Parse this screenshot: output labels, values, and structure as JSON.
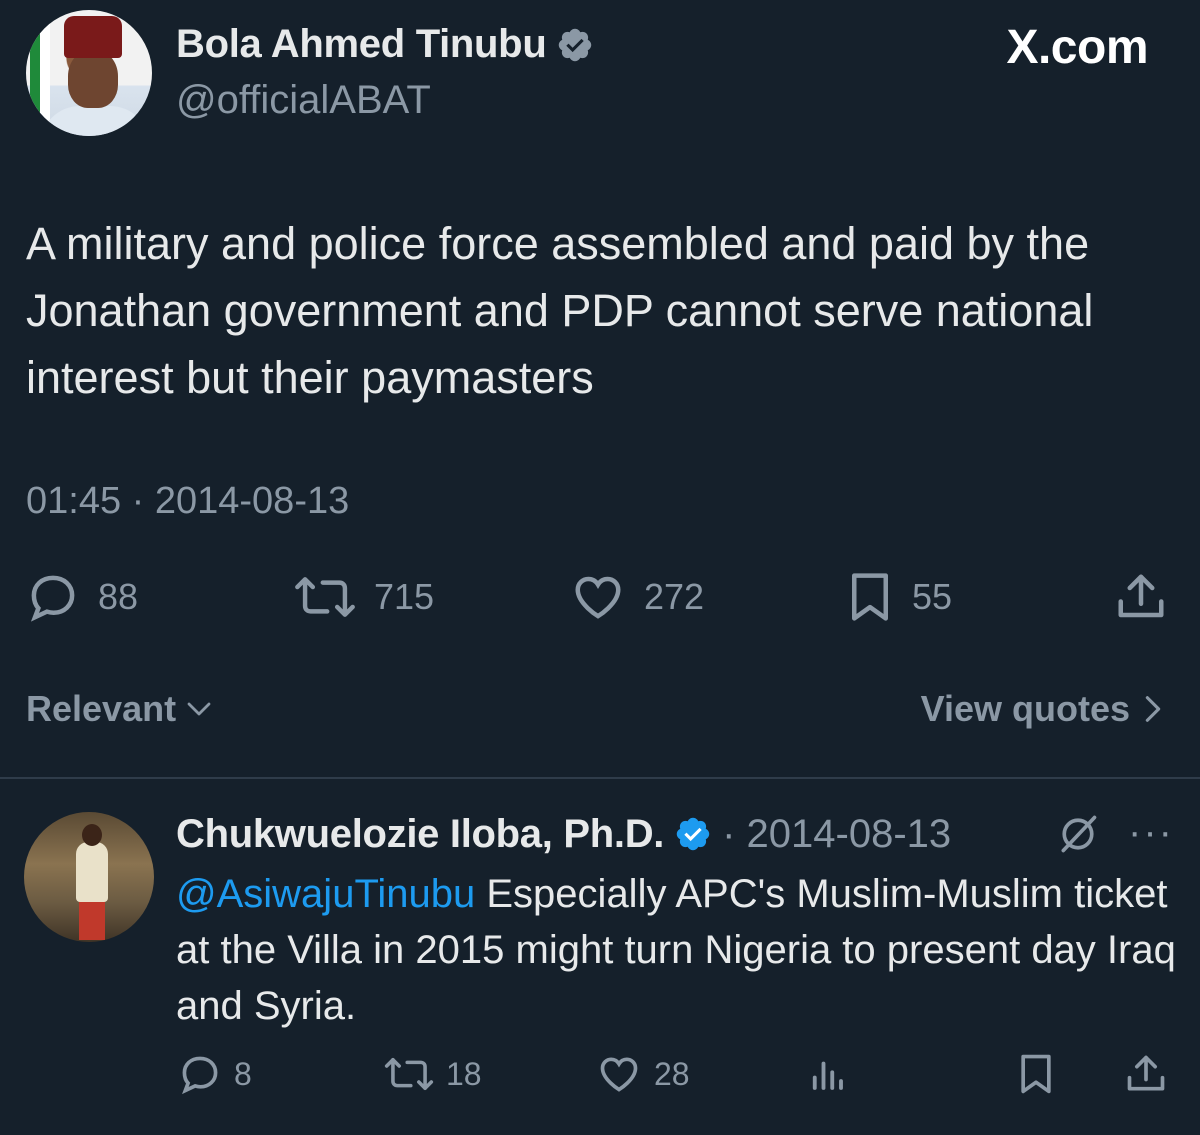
{
  "header": {
    "display_name": "Bola Ahmed Tinubu",
    "handle": "@officialABAT",
    "brand": "X.com",
    "avatar_icon": "profile-photo",
    "verified_icon": "verified-badge-icon"
  },
  "tweet": {
    "text": "A military and police force assembled and paid by the Jonathan government and PDP cannot serve national interest but their paymasters",
    "timestamp": "01:45 · 2014-08-13",
    "replies": "88",
    "retweets": "715",
    "likes": "272",
    "bookmarks": "55"
  },
  "sort": {
    "relevant_label": "Relevant",
    "view_quotes_label": "View quotes"
  },
  "reply": {
    "name": "Chukwuelozie Iloba, Ph.D.",
    "date": "· 2014-08-13",
    "mention": "@AsiwajuTinubu",
    "text": " Especially APC's Muslim-Muslim ticket at the Villa in 2015 might turn Nigeria to present day Iraq and Syria.",
    "replies": "8",
    "retweets": "18",
    "likes": "28",
    "more": "···"
  },
  "colors": {
    "background": "#15202b",
    "text": "#e7e9ea",
    "muted": "#8b98a5",
    "link": "#1d9bf0",
    "verified": "#1d9bf0"
  }
}
